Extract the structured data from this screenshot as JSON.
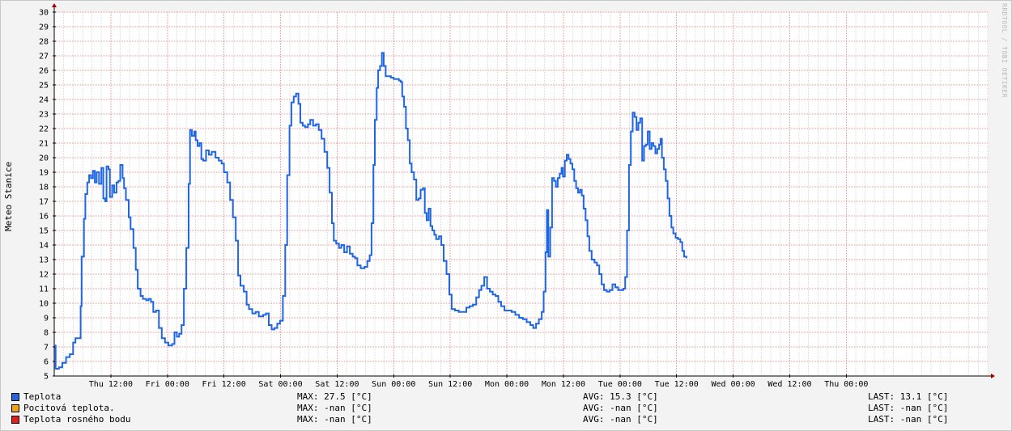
{
  "watermark": "RRDTOOL / TOBI OETIKER",
  "chart_data": {
    "type": "line",
    "ylabel": "Meteo Stanice",
    "ylim": [
      5,
      30
    ],
    "y_ticks": [
      5,
      6,
      7,
      8,
      9,
      10,
      11,
      12,
      13,
      14,
      15,
      16,
      17,
      18,
      19,
      20,
      21,
      22,
      23,
      24,
      25,
      26,
      27,
      28,
      29,
      30
    ],
    "x_unit": "hours",
    "xlim": [
      -6,
      192
    ],
    "x_ticks": [
      {
        "x": 6,
        "label": "Thu 12:00"
      },
      {
        "x": 18,
        "label": "Fri 00:00"
      },
      {
        "x": 30,
        "label": "Fri 12:00"
      },
      {
        "x": 42,
        "label": "Sat 00:00"
      },
      {
        "x": 54,
        "label": "Sat 12:00"
      },
      {
        "x": 66,
        "label": "Sun 00:00"
      },
      {
        "x": 78,
        "label": "Sun 12:00"
      },
      {
        "x": 90,
        "label": "Mon 00:00"
      },
      {
        "x": 102,
        "label": "Mon 12:00"
      },
      {
        "x": 114,
        "label": "Tue 00:00"
      },
      {
        "x": 126,
        "label": "Tue 12:00"
      },
      {
        "x": 138,
        "label": "Wed 00:00"
      },
      {
        "x": 150,
        "label": "Wed 12:00"
      },
      {
        "x": 162,
        "label": "Thu 00:00"
      }
    ],
    "grid": true,
    "series": [
      {
        "name": "Teplota",
        "color": "#1f66e5",
        "points": [
          [
            -6.0,
            7.1
          ],
          [
            -5.7,
            5.5
          ],
          [
            -5.0,
            5.6
          ],
          [
            -4.3,
            5.9
          ],
          [
            -3.5,
            6.3
          ],
          [
            -2.7,
            6.5
          ],
          [
            -2.0,
            7.3
          ],
          [
            -1.5,
            7.6
          ],
          [
            -0.6,
            7.6
          ],
          [
            -0.4,
            9.8
          ],
          [
            -0.2,
            13.2
          ],
          [
            0.3,
            15.8
          ],
          [
            0.6,
            17.5
          ],
          [
            1.0,
            18.3
          ],
          [
            1.4,
            18.8
          ],
          [
            1.8,
            18.6
          ],
          [
            2.2,
            19.1
          ],
          [
            2.6,
            18.3
          ],
          [
            3.0,
            19.0
          ],
          [
            3.5,
            18.2
          ],
          [
            4.0,
            19.3
          ],
          [
            4.4,
            17.2
          ],
          [
            4.8,
            17.0
          ],
          [
            5.1,
            19.4
          ],
          [
            5.5,
            19.2
          ],
          [
            5.8,
            17.3
          ],
          [
            6.3,
            18.1
          ],
          [
            6.7,
            17.6
          ],
          [
            7.2,
            18.3
          ],
          [
            7.6,
            18.4
          ],
          [
            8.0,
            19.5
          ],
          [
            8.5,
            18.6
          ],
          [
            8.8,
            17.9
          ],
          [
            9.2,
            17.1
          ],
          [
            9.8,
            15.9
          ],
          [
            10.2,
            15.1
          ],
          [
            10.8,
            13.8
          ],
          [
            11.3,
            12.3
          ],
          [
            11.7,
            11.0
          ],
          [
            12.3,
            10.5
          ],
          [
            12.8,
            10.3
          ],
          [
            13.5,
            10.2
          ],
          [
            14.0,
            10.3
          ],
          [
            14.5,
            10.1
          ],
          [
            15.0,
            9.4
          ],
          [
            15.6,
            9.5
          ],
          [
            16.2,
            8.3
          ],
          [
            16.8,
            7.6
          ],
          [
            17.5,
            7.3
          ],
          [
            18.2,
            7.1
          ],
          [
            19.0,
            7.2
          ],
          [
            19.5,
            8.0
          ],
          [
            20.0,
            7.7
          ],
          [
            20.5,
            7.9
          ],
          [
            21.0,
            8.5
          ],
          [
            21.5,
            11.0
          ],
          [
            22.0,
            13.8
          ],
          [
            22.5,
            18.2
          ],
          [
            22.8,
            21.9
          ],
          [
            23.2,
            21.5
          ],
          [
            23.7,
            21.8
          ],
          [
            24.0,
            21.2
          ],
          [
            24.4,
            20.8
          ],
          [
            24.8,
            21.0
          ],
          [
            25.2,
            19.9
          ],
          [
            25.6,
            19.8
          ],
          [
            26.2,
            20.5
          ],
          [
            26.8,
            20.2
          ],
          [
            27.4,
            20.4
          ],
          [
            28.2,
            20.0
          ],
          [
            28.9,
            19.8
          ],
          [
            29.5,
            19.6
          ],
          [
            30.0,
            19.0
          ],
          [
            30.7,
            18.3
          ],
          [
            31.3,
            17.1
          ],
          [
            31.9,
            15.9
          ],
          [
            32.5,
            14.3
          ],
          [
            33.0,
            11.9
          ],
          [
            33.5,
            11.2
          ],
          [
            34.2,
            10.8
          ],
          [
            34.8,
            9.9
          ],
          [
            35.3,
            9.6
          ],
          [
            36.0,
            9.3
          ],
          [
            36.7,
            9.4
          ],
          [
            37.4,
            9.1
          ],
          [
            38.3,
            9.2
          ],
          [
            38.9,
            9.3
          ],
          [
            39.5,
            8.5
          ],
          [
            40.1,
            8.2
          ],
          [
            40.7,
            8.3
          ],
          [
            41.3,
            8.6
          ],
          [
            41.9,
            8.8
          ],
          [
            42.5,
            10.5
          ],
          [
            43.0,
            14.0
          ],
          [
            43.4,
            18.8
          ],
          [
            43.9,
            22.2
          ],
          [
            44.3,
            23.8
          ],
          [
            44.8,
            24.2
          ],
          [
            45.3,
            24.4
          ],
          [
            45.8,
            23.7
          ],
          [
            46.2,
            22.4
          ],
          [
            46.7,
            22.2
          ],
          [
            47.2,
            22.1
          ],
          [
            47.8,
            22.3
          ],
          [
            48.3,
            22.6
          ],
          [
            48.9,
            22.2
          ],
          [
            49.5,
            22.3
          ],
          [
            50.1,
            21.9
          ],
          [
            50.7,
            21.3
          ],
          [
            51.3,
            20.4
          ],
          [
            51.9,
            19.3
          ],
          [
            52.4,
            17.6
          ],
          [
            52.9,
            15.5
          ],
          [
            53.3,
            14.3
          ],
          [
            53.8,
            14.1
          ],
          [
            54.4,
            13.8
          ],
          [
            54.9,
            14.0
          ],
          [
            55.5,
            13.5
          ],
          [
            56.1,
            13.9
          ],
          [
            56.7,
            13.4
          ],
          [
            57.3,
            13.2
          ],
          [
            57.8,
            13.1
          ],
          [
            58.3,
            12.6
          ],
          [
            59.0,
            12.4
          ],
          [
            59.8,
            12.5
          ],
          [
            60.4,
            12.9
          ],
          [
            60.9,
            13.3
          ],
          [
            61.3,
            15.5
          ],
          [
            61.7,
            19.5
          ],
          [
            62.0,
            22.6
          ],
          [
            62.4,
            24.8
          ],
          [
            62.7,
            26.0
          ],
          [
            63.1,
            26.3
          ],
          [
            63.5,
            27.2
          ],
          [
            63.9,
            26.3
          ],
          [
            64.3,
            25.6
          ],
          [
            64.8,
            25.6
          ],
          [
            65.4,
            25.5
          ],
          [
            66.0,
            25.4
          ],
          [
            66.6,
            25.4
          ],
          [
            67.1,
            25.3
          ],
          [
            67.5,
            25.2
          ],
          [
            67.8,
            24.2
          ],
          [
            68.2,
            23.5
          ],
          [
            68.6,
            22.0
          ],
          [
            69.0,
            21.2
          ],
          [
            69.4,
            19.6
          ],
          [
            69.8,
            19.0
          ],
          [
            70.3,
            18.5
          ],
          [
            70.8,
            17.1
          ],
          [
            71.3,
            17.2
          ],
          [
            71.7,
            17.8
          ],
          [
            72.2,
            17.9
          ],
          [
            72.6,
            16.2
          ],
          [
            73.0,
            15.7
          ],
          [
            73.4,
            16.5
          ],
          [
            73.8,
            15.3
          ],
          [
            74.2,
            15.0
          ],
          [
            74.6,
            14.7
          ],
          [
            75.0,
            14.4
          ],
          [
            75.6,
            14.6
          ],
          [
            76.1,
            14.0
          ],
          [
            76.6,
            12.9
          ],
          [
            77.2,
            12.0
          ],
          [
            77.8,
            10.6
          ],
          [
            78.3,
            9.6
          ],
          [
            79.0,
            9.5
          ],
          [
            79.8,
            9.4
          ],
          [
            80.6,
            9.4
          ],
          [
            81.4,
            9.7
          ],
          [
            82.1,
            9.8
          ],
          [
            82.8,
            9.9
          ],
          [
            83.5,
            10.4
          ],
          [
            84.1,
            10.9
          ],
          [
            84.6,
            11.2
          ],
          [
            85.2,
            11.8
          ],
          [
            85.8,
            11.0
          ],
          [
            86.4,
            10.8
          ],
          [
            87.0,
            10.6
          ],
          [
            87.6,
            10.5
          ],
          [
            88.2,
            10.1
          ],
          [
            88.8,
            9.8
          ],
          [
            89.5,
            9.5
          ],
          [
            90.3,
            9.5
          ],
          [
            91.0,
            9.4
          ],
          [
            91.8,
            9.2
          ],
          [
            92.6,
            9.0
          ],
          [
            93.4,
            8.9
          ],
          [
            94.2,
            8.7
          ],
          [
            95.0,
            8.5
          ],
          [
            95.6,
            8.3
          ],
          [
            96.2,
            8.6
          ],
          [
            96.8,
            8.9
          ],
          [
            97.4,
            9.4
          ],
          [
            97.8,
            10.8
          ],
          [
            98.2,
            13.5
          ],
          [
            98.5,
            16.4
          ],
          [
            98.8,
            13.2
          ],
          [
            99.2,
            15.2
          ],
          [
            99.6,
            18.6
          ],
          [
            100.0,
            18.4
          ],
          [
            100.4,
            18.0
          ],
          [
            100.8,
            18.6
          ],
          [
            101.2,
            18.9
          ],
          [
            101.6,
            19.3
          ],
          [
            101.9,
            18.7
          ],
          [
            102.3,
            19.8
          ],
          [
            102.7,
            20.2
          ],
          [
            103.1,
            19.9
          ],
          [
            103.5,
            19.6
          ],
          [
            103.9,
            19.2
          ],
          [
            104.3,
            18.4
          ],
          [
            104.7,
            17.9
          ],
          [
            105.1,
            17.6
          ],
          [
            105.5,
            17.8
          ],
          [
            105.9,
            17.4
          ],
          [
            106.3,
            16.5
          ],
          [
            106.7,
            15.7
          ],
          [
            107.1,
            14.6
          ],
          [
            107.5,
            13.6
          ],
          [
            108.0,
            13.0
          ],
          [
            108.6,
            12.8
          ],
          [
            109.1,
            12.6
          ],
          [
            109.6,
            12.0
          ],
          [
            110.1,
            11.3
          ],
          [
            110.6,
            10.9
          ],
          [
            111.2,
            10.8
          ],
          [
            111.8,
            10.9
          ],
          [
            112.4,
            11.3
          ],
          [
            113.0,
            11.1
          ],
          [
            113.6,
            10.9
          ],
          [
            114.2,
            10.9
          ],
          [
            114.7,
            11.0
          ],
          [
            115.1,
            11.8
          ],
          [
            115.5,
            15.0
          ],
          [
            115.9,
            19.5
          ],
          [
            116.3,
            21.8
          ],
          [
            116.7,
            23.1
          ],
          [
            117.1,
            22.8
          ],
          [
            117.5,
            21.9
          ],
          [
            117.9,
            22.4
          ],
          [
            118.3,
            22.7
          ],
          [
            118.7,
            19.8
          ],
          [
            119.1,
            20.8
          ],
          [
            119.5,
            20.9
          ],
          [
            119.9,
            21.8
          ],
          [
            120.3,
            20.6
          ],
          [
            120.7,
            21.0
          ],
          [
            121.1,
            20.8
          ],
          [
            121.5,
            20.3
          ],
          [
            121.9,
            20.6
          ],
          [
            122.3,
            20.9
          ],
          [
            122.6,
            21.3
          ],
          [
            122.9,
            20.0
          ],
          [
            123.3,
            19.2
          ],
          [
            123.7,
            18.4
          ],
          [
            124.1,
            17.2
          ],
          [
            124.5,
            16.0
          ],
          [
            124.9,
            15.2
          ],
          [
            125.3,
            14.8
          ],
          [
            125.8,
            14.5
          ],
          [
            126.3,
            14.4
          ],
          [
            126.8,
            14.2
          ],
          [
            127.2,
            13.6
          ],
          [
            127.6,
            13.2
          ],
          [
            128.1,
            13.1
          ]
        ],
        "stats": {
          "max": "MAX: 27.5 [°C]",
          "avg": "AVG: 15.3 [°C]",
          "last": "LAST: 13.1 [°C]"
        }
      },
      {
        "name": "Pocitová teplota.",
        "color": "#f5a30d",
        "points": [],
        "stats": {
          "max": "MAX: -nan [°C]",
          "avg": "AVG: -nan [°C]",
          "last": "LAST: -nan [°C]"
        }
      },
      {
        "name": "Teplota rosného bodu",
        "color": "#e51d1d",
        "points": [],
        "stats": {
          "max": "MAX: -nan [°C]",
          "avg": "AVG: -nan [°C]",
          "last": "LAST: -nan [°C]"
        }
      }
    ]
  }
}
